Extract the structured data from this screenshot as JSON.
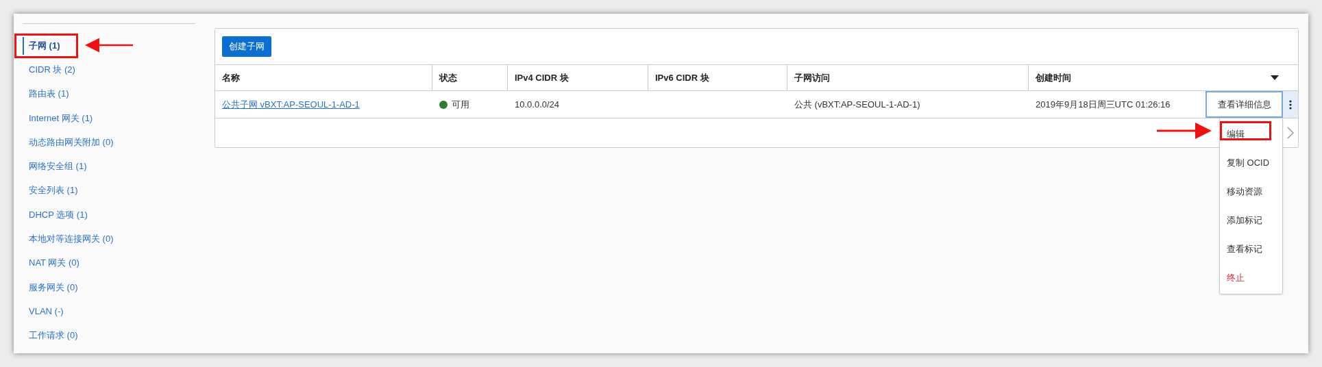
{
  "sidebar": {
    "items": [
      {
        "label": "子网 (1)",
        "selected": true,
        "highlighted": true
      },
      {
        "label": "CIDR 块 (2)",
        "selected": false,
        "highlighted": false
      },
      {
        "label": "路由表 (1)",
        "selected": false,
        "highlighted": false
      },
      {
        "label": "Internet 网关 (1)",
        "selected": false,
        "highlighted": false
      },
      {
        "label": "动态路由网关附加 (0)",
        "selected": false,
        "highlighted": false
      },
      {
        "label": "网络安全组 (1)",
        "selected": false,
        "highlighted": false
      },
      {
        "label": "安全列表 (1)",
        "selected": false,
        "highlighted": false
      },
      {
        "label": "DHCP 选项 (1)",
        "selected": false,
        "highlighted": false
      },
      {
        "label": "本地对等连接网关 (0)",
        "selected": false,
        "highlighted": false
      },
      {
        "label": "NAT 网关 (0)",
        "selected": false,
        "highlighted": false
      },
      {
        "label": "服务网关 (0)",
        "selected": false,
        "highlighted": false
      },
      {
        "label": "VLAN (-)",
        "selected": false,
        "highlighted": false
      },
      {
        "label": "工作请求 (0)",
        "selected": false,
        "highlighted": false
      }
    ]
  },
  "toolbar": {
    "create_button": "创建子网"
  },
  "table": {
    "columns": [
      "名称",
      "状态",
      "IPv4 CIDR 块",
      "IPv6 CIDR 块",
      "子网访问",
      "创建时间"
    ],
    "rows": [
      {
        "name": "公共子网 vBXT:AP-SEOUL-1-AD-1",
        "status": "可用",
        "color": "#2e7d32",
        "ipv4": "10.0.0.0/24",
        "access": "公共 (vBXT:AP-SEOUL-1-AD-1)",
        "created": "2019年9月18日周三UTC 01:26:16",
        "action_button": "查看详细信息"
      }
    ]
  },
  "action_menu": {
    "items": [
      {
        "label": "编辑",
        "kind": "normal",
        "highlighted": true
      },
      {
        "label": "复制 OCID",
        "kind": "normal",
        "highlighted": false
      },
      {
        "label": "移动资源",
        "kind": "normal",
        "highlighted": false
      },
      {
        "label": "添加标记",
        "kind": "normal",
        "highlighted": false
      },
      {
        "label": "查看标记",
        "kind": "normal",
        "highlighted": false
      },
      {
        "label": "终止",
        "kind": "danger",
        "highlighted": false
      }
    ]
  }
}
